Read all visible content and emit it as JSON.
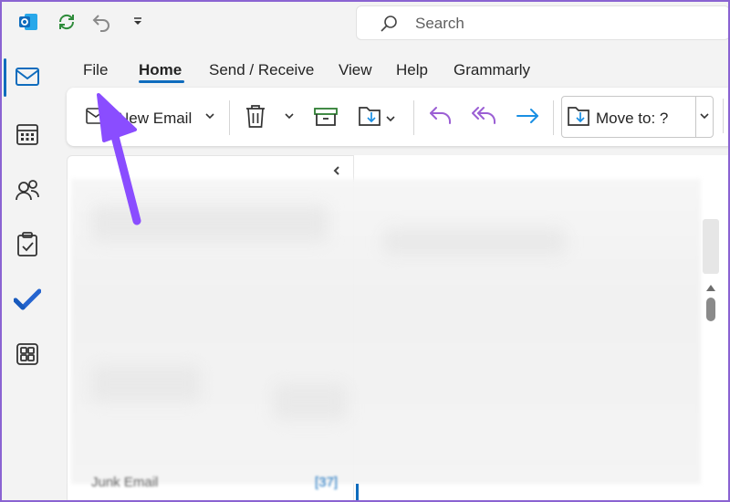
{
  "titlebar": {
    "icons": [
      "outlook-logo-icon",
      "sync-icon",
      "undo-icon",
      "customize-qat-icon"
    ],
    "search_placeholder": "Search"
  },
  "rail": {
    "items": [
      {
        "name": "mail-icon",
        "active": true
      },
      {
        "name": "calendar-icon"
      },
      {
        "name": "people-icon"
      },
      {
        "name": "tasks-icon"
      },
      {
        "name": "todo-icon"
      },
      {
        "name": "apps-icon"
      }
    ]
  },
  "tabs": [
    {
      "label": "File"
    },
    {
      "label": "Home",
      "active": true
    },
    {
      "label": "Send / Receive"
    },
    {
      "label": "View"
    },
    {
      "label": "Help"
    },
    {
      "label": "Grammarly"
    }
  ],
  "ribbon": {
    "new_email_label": "New Email",
    "move_to_label": "Move to: ?"
  },
  "folder_pane": {
    "junk_label": "Junk Email",
    "junk_count": "[37]"
  },
  "colors": {
    "accent": "#0f6cbd",
    "annotation_arrow": "#8a4dff",
    "reply_purple": "#9b5fd4",
    "forward_blue": "#1a8fe3"
  }
}
